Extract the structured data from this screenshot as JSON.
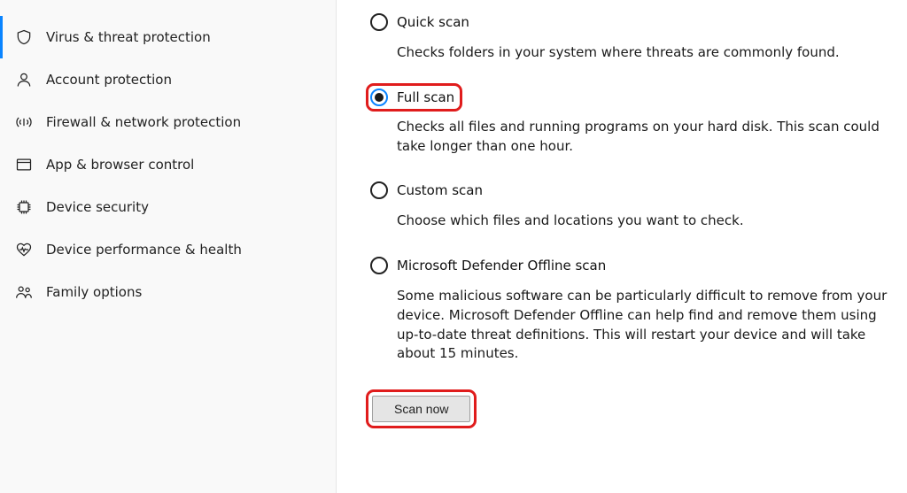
{
  "sidebar": {
    "items": [
      {
        "label": "Virus & threat protection"
      },
      {
        "label": "Account protection"
      },
      {
        "label": "Firewall & network protection"
      },
      {
        "label": "App & browser control"
      },
      {
        "label": "Device security"
      },
      {
        "label": "Device performance & health"
      },
      {
        "label": "Family options"
      }
    ]
  },
  "scan_options": {
    "quick": {
      "title": "Quick scan",
      "desc": "Checks folders in your system where threats are commonly found."
    },
    "full": {
      "title": "Full scan",
      "desc": "Checks all files and running programs on your hard disk. This scan could take longer than one hour."
    },
    "custom": {
      "title": "Custom scan",
      "desc": "Choose which files and locations you want to check."
    },
    "offline": {
      "title": "Microsoft Defender Offline scan",
      "desc": "Some malicious software can be particularly difficult to remove from your device. Microsoft Defender Offline can help find and remove them using up-to-date threat definitions. This will restart your device and will take about 15 minutes."
    }
  },
  "actions": {
    "scan_now": "Scan now"
  }
}
